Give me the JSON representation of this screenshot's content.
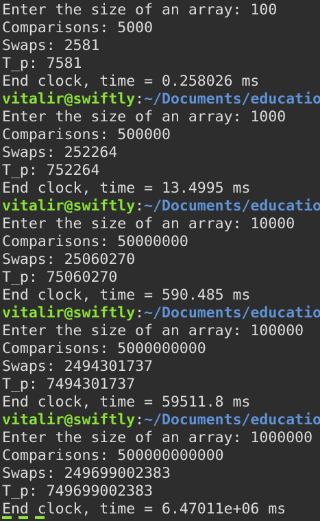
{
  "terminal": {
    "prompt": {
      "user_host": "vitalir@swiftly",
      "separator": ":",
      "path": "~/Documents/educatio"
    },
    "runs": [
      {
        "input_line": "Enter the size of an array: 100",
        "comparisons": "Comparisons: 5000",
        "swaps": "Swaps: 2581",
        "t_p": "T_p: 7581",
        "time": "End clock, time = 0.258026 ms"
      },
      {
        "input_line": "Enter the size of an array: 1000",
        "comparisons": "Comparisons: 500000",
        "swaps": "Swaps: 252264",
        "t_p": "T_p: 752264",
        "time": "End clock, time = 13.4995 ms"
      },
      {
        "input_line": "Enter the size of an array: 10000",
        "comparisons": "Comparisons: 50000000",
        "swaps": "Swaps: 25060270",
        "t_p": "T_p: 75060270",
        "time": "End clock, time = 590.485 ms"
      },
      {
        "input_line": "Enter the size of an array: 100000",
        "comparisons": "Comparisons: 5000000000",
        "swaps": "Swaps: 2494301737",
        "t_p": "T_p: 7494301737",
        "time": "End clock, time = 59511.8 ms"
      },
      {
        "input_line": "Enter the size of an array: 1000000",
        "comparisons": "Comparisons: 500000000000",
        "swaps": "Swaps: 249699002383",
        "t_p": "T_p: 749699002383",
        "time": "End clock, time = 6.47011e+06 ms"
      }
    ]
  },
  "colors": {
    "background": "#2d2d2d",
    "text": "#dcdcdc",
    "prompt_user": "#8ae234",
    "prompt_path": "#5f93d8"
  }
}
